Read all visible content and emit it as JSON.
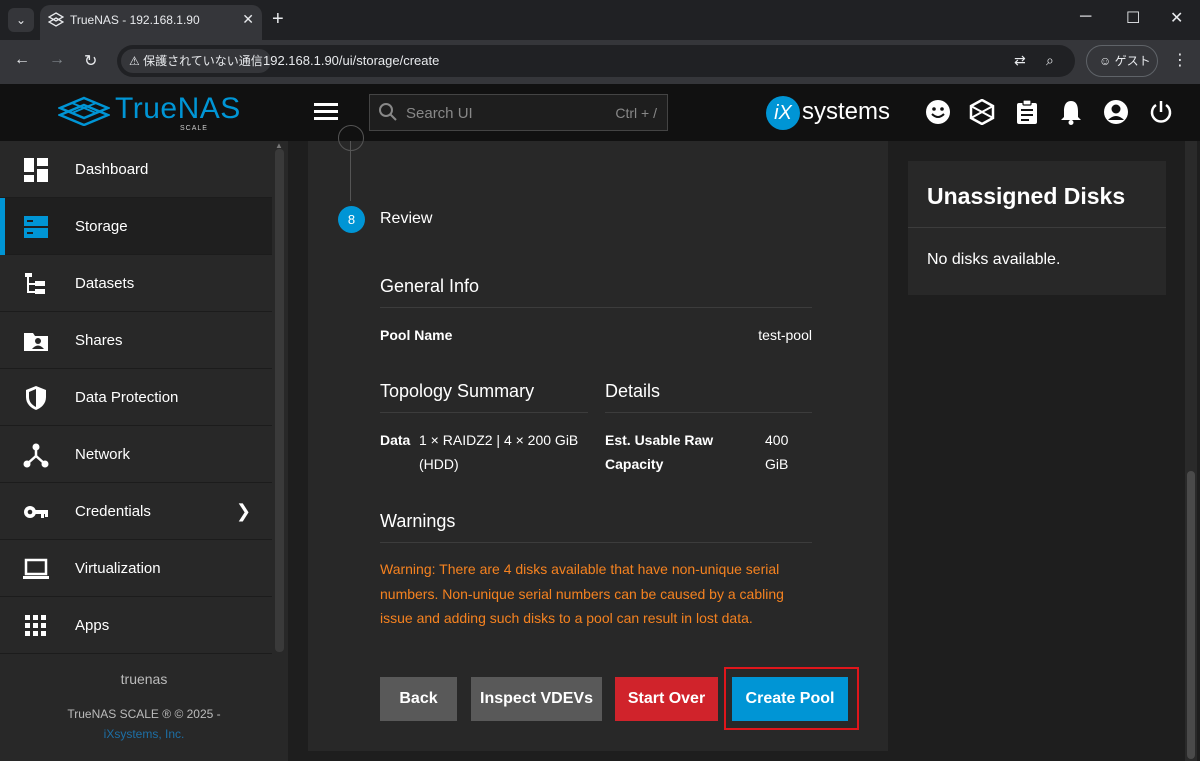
{
  "browser": {
    "tab_title": "TrueNAS - 192.168.1.90",
    "security_chip": "保護されていない通信",
    "url": "192.168.1.90/ui/storage/create",
    "guest_label": "ゲスト"
  },
  "topbar": {
    "logo_text": "TrueNAS",
    "logo_sub": "SCALE",
    "search_placeholder": "Search UI",
    "search_shortcut": "Ctrl + /",
    "ix_letters": "iX",
    "ix_text": "systems"
  },
  "sidebar": {
    "items": [
      {
        "label": "Dashboard"
      },
      {
        "label": "Storage",
        "active": true
      },
      {
        "label": "Datasets"
      },
      {
        "label": "Shares"
      },
      {
        "label": "Data Protection"
      },
      {
        "label": "Network"
      },
      {
        "label": "Credentials",
        "has_submenu": true
      },
      {
        "label": "Virtualization"
      },
      {
        "label": "Apps"
      }
    ],
    "hostname": "truenas",
    "copyright": "TrueNAS SCALE ® © 2025 -",
    "company_link": "iXsystems, Inc."
  },
  "wizard": {
    "step_number": "8",
    "step_title": "Review",
    "general_info": {
      "heading": "General Info",
      "pool_name_label": "Pool Name",
      "pool_name_value": "test-pool"
    },
    "topology": {
      "heading": "Topology Summary",
      "data_label": "Data",
      "data_value_line1": "1 × RAIDZ2 | 4 × 200 GiB",
      "data_value_line2": "(HDD)"
    },
    "details": {
      "heading": "Details",
      "usable_label_line1": "Est. Usable Raw",
      "usable_label_line2": "Capacity",
      "usable_value_line1": "400",
      "usable_value_line2": "GiB"
    },
    "warnings": {
      "heading": "Warnings",
      "text": "Warning: There are 4 disks available that have non-unique serial numbers. Non-unique serial numbers can be caused by a cabling issue and adding such disks to a pool can result in lost data."
    },
    "buttons": {
      "back": "Back",
      "inspect": "Inspect VDEVs",
      "start_over": "Start Over",
      "create": "Create Pool"
    }
  },
  "unassigned_disks": {
    "title": "Unassigned Disks",
    "empty_text": "No disks available."
  },
  "colors": {
    "accent": "#0095d5",
    "danger": "#d0232b",
    "warning": "#f58220",
    "highlight": "#e0161b"
  }
}
